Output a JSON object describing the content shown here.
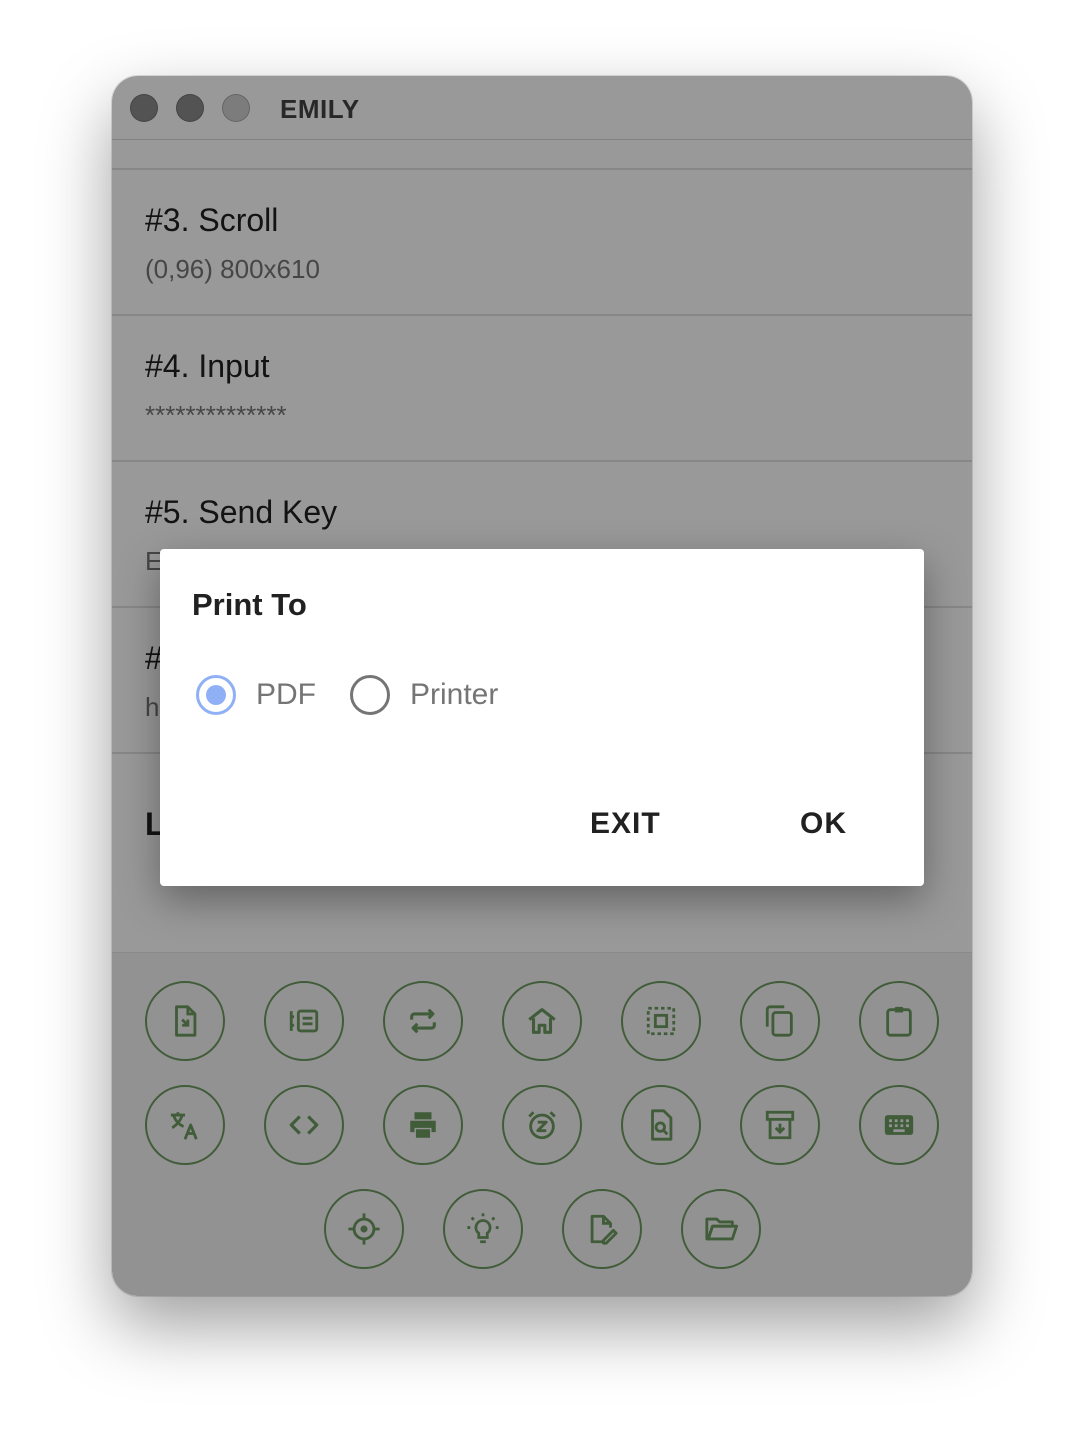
{
  "window": {
    "title": "EMILY"
  },
  "list": {
    "items": [
      {
        "title": "#3. Scroll",
        "subtitle": "(0,96) 800x610"
      },
      {
        "title": "#4. Input",
        "subtitle": "**************"
      },
      {
        "title": "#5. Send Key",
        "subtitle": "E"
      },
      {
        "title": "#",
        "subtitle": "h"
      },
      {
        "title": "L",
        "subtitle": ""
      }
    ]
  },
  "toolbar": {
    "icon_color": "#6c9a5f",
    "buttons": [
      {
        "icon": "file-export-icon"
      },
      {
        "icon": "list-icon"
      },
      {
        "icon": "repeat-icon"
      },
      {
        "icon": "home-icon"
      },
      {
        "icon": "select-area-icon"
      },
      {
        "icon": "copy-icon"
      },
      {
        "icon": "clipboard-icon"
      },
      {
        "icon": "translate-icon"
      },
      {
        "icon": "code-icon"
      },
      {
        "icon": "print-icon"
      },
      {
        "icon": "alarm-snooze-icon"
      },
      {
        "icon": "find-in-page-icon"
      },
      {
        "icon": "archive-icon"
      },
      {
        "icon": "keyboard-icon"
      },
      {
        "icon": "crosshair-icon"
      },
      {
        "icon": "lightbulb-icon"
      },
      {
        "icon": "edit-file-icon"
      },
      {
        "icon": "folder-open-icon"
      }
    ]
  },
  "dialog": {
    "title": "Print To",
    "options": [
      {
        "label": "PDF",
        "selected": true
      },
      {
        "label": "Printer",
        "selected": false
      }
    ],
    "exit_label": "EXIT",
    "ok_label": "OK",
    "radio_accent": "#90b0f5"
  }
}
